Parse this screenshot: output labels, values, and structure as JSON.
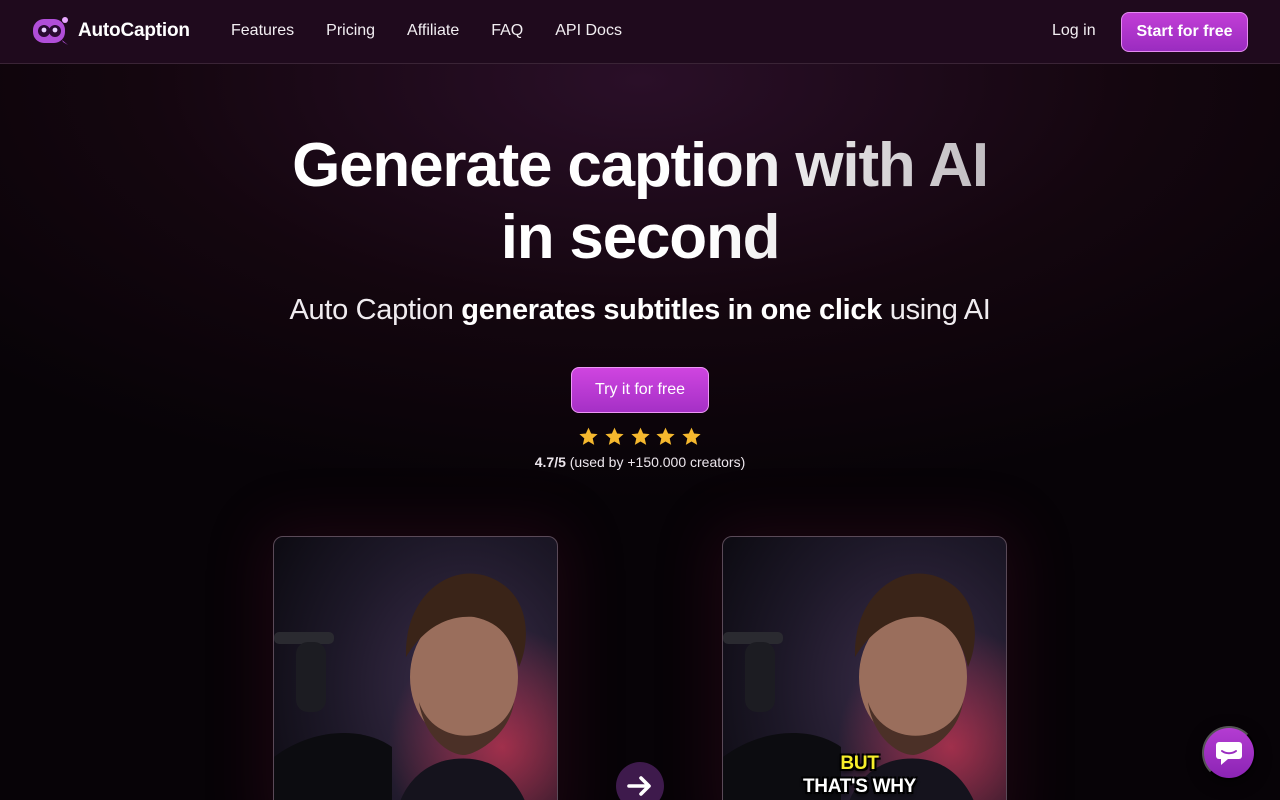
{
  "brand": {
    "name": "AutoCaption",
    "logo_icon": "robot-face-icon",
    "accent": "#b63ad0"
  },
  "nav": {
    "links": [
      "Features",
      "Pricing",
      "Affiliate",
      "FAQ",
      "API Docs"
    ],
    "login": "Log in",
    "cta": "Start for free"
  },
  "hero": {
    "headline_line1": "Generate caption with AI",
    "headline_line2": "in second",
    "sub_plain1": "Auto Caption ",
    "sub_bold": "generates subtitles in one click",
    "sub_plain2": " using AI",
    "cta": "Try it for free",
    "stars": 5,
    "star_color": "#f5b82e",
    "rating_value": "4.7/5",
    "rating_note": " (used by +150.000 creators)"
  },
  "demo": {
    "caption_line1": "BUT",
    "caption_line2": "THAT'S WHY",
    "arrow_icon": "arrow-right-icon"
  },
  "chat": {
    "icon": "chat-bubble-icon"
  }
}
